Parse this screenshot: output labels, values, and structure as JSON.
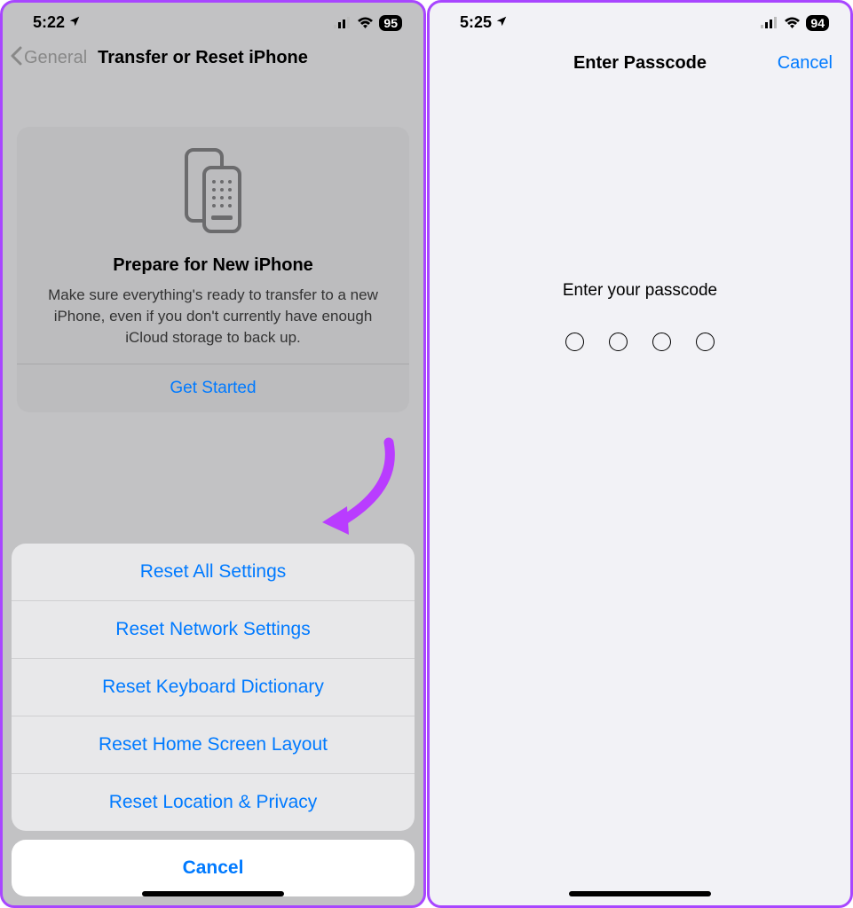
{
  "left": {
    "status": {
      "time": "5:22",
      "battery": "95"
    },
    "nav": {
      "back": "General",
      "title": "Transfer or Reset iPhone"
    },
    "card": {
      "title": "Prepare for New iPhone",
      "desc": "Make sure everything's ready to transfer to a new iPhone, even if you don't currently have enough iCloud storage to back up.",
      "action": "Get Started"
    },
    "sheet": {
      "items": [
        "Reset All Settings",
        "Reset Network Settings",
        "Reset Keyboard Dictionary",
        "Reset Home Screen Layout",
        "Reset Location & Privacy"
      ],
      "cancel": "Cancel"
    }
  },
  "right": {
    "status": {
      "time": "5:25",
      "battery": "94"
    },
    "nav": {
      "title": "Enter Passcode",
      "cancel": "Cancel"
    },
    "prompt": "Enter your passcode",
    "digits": 4
  }
}
